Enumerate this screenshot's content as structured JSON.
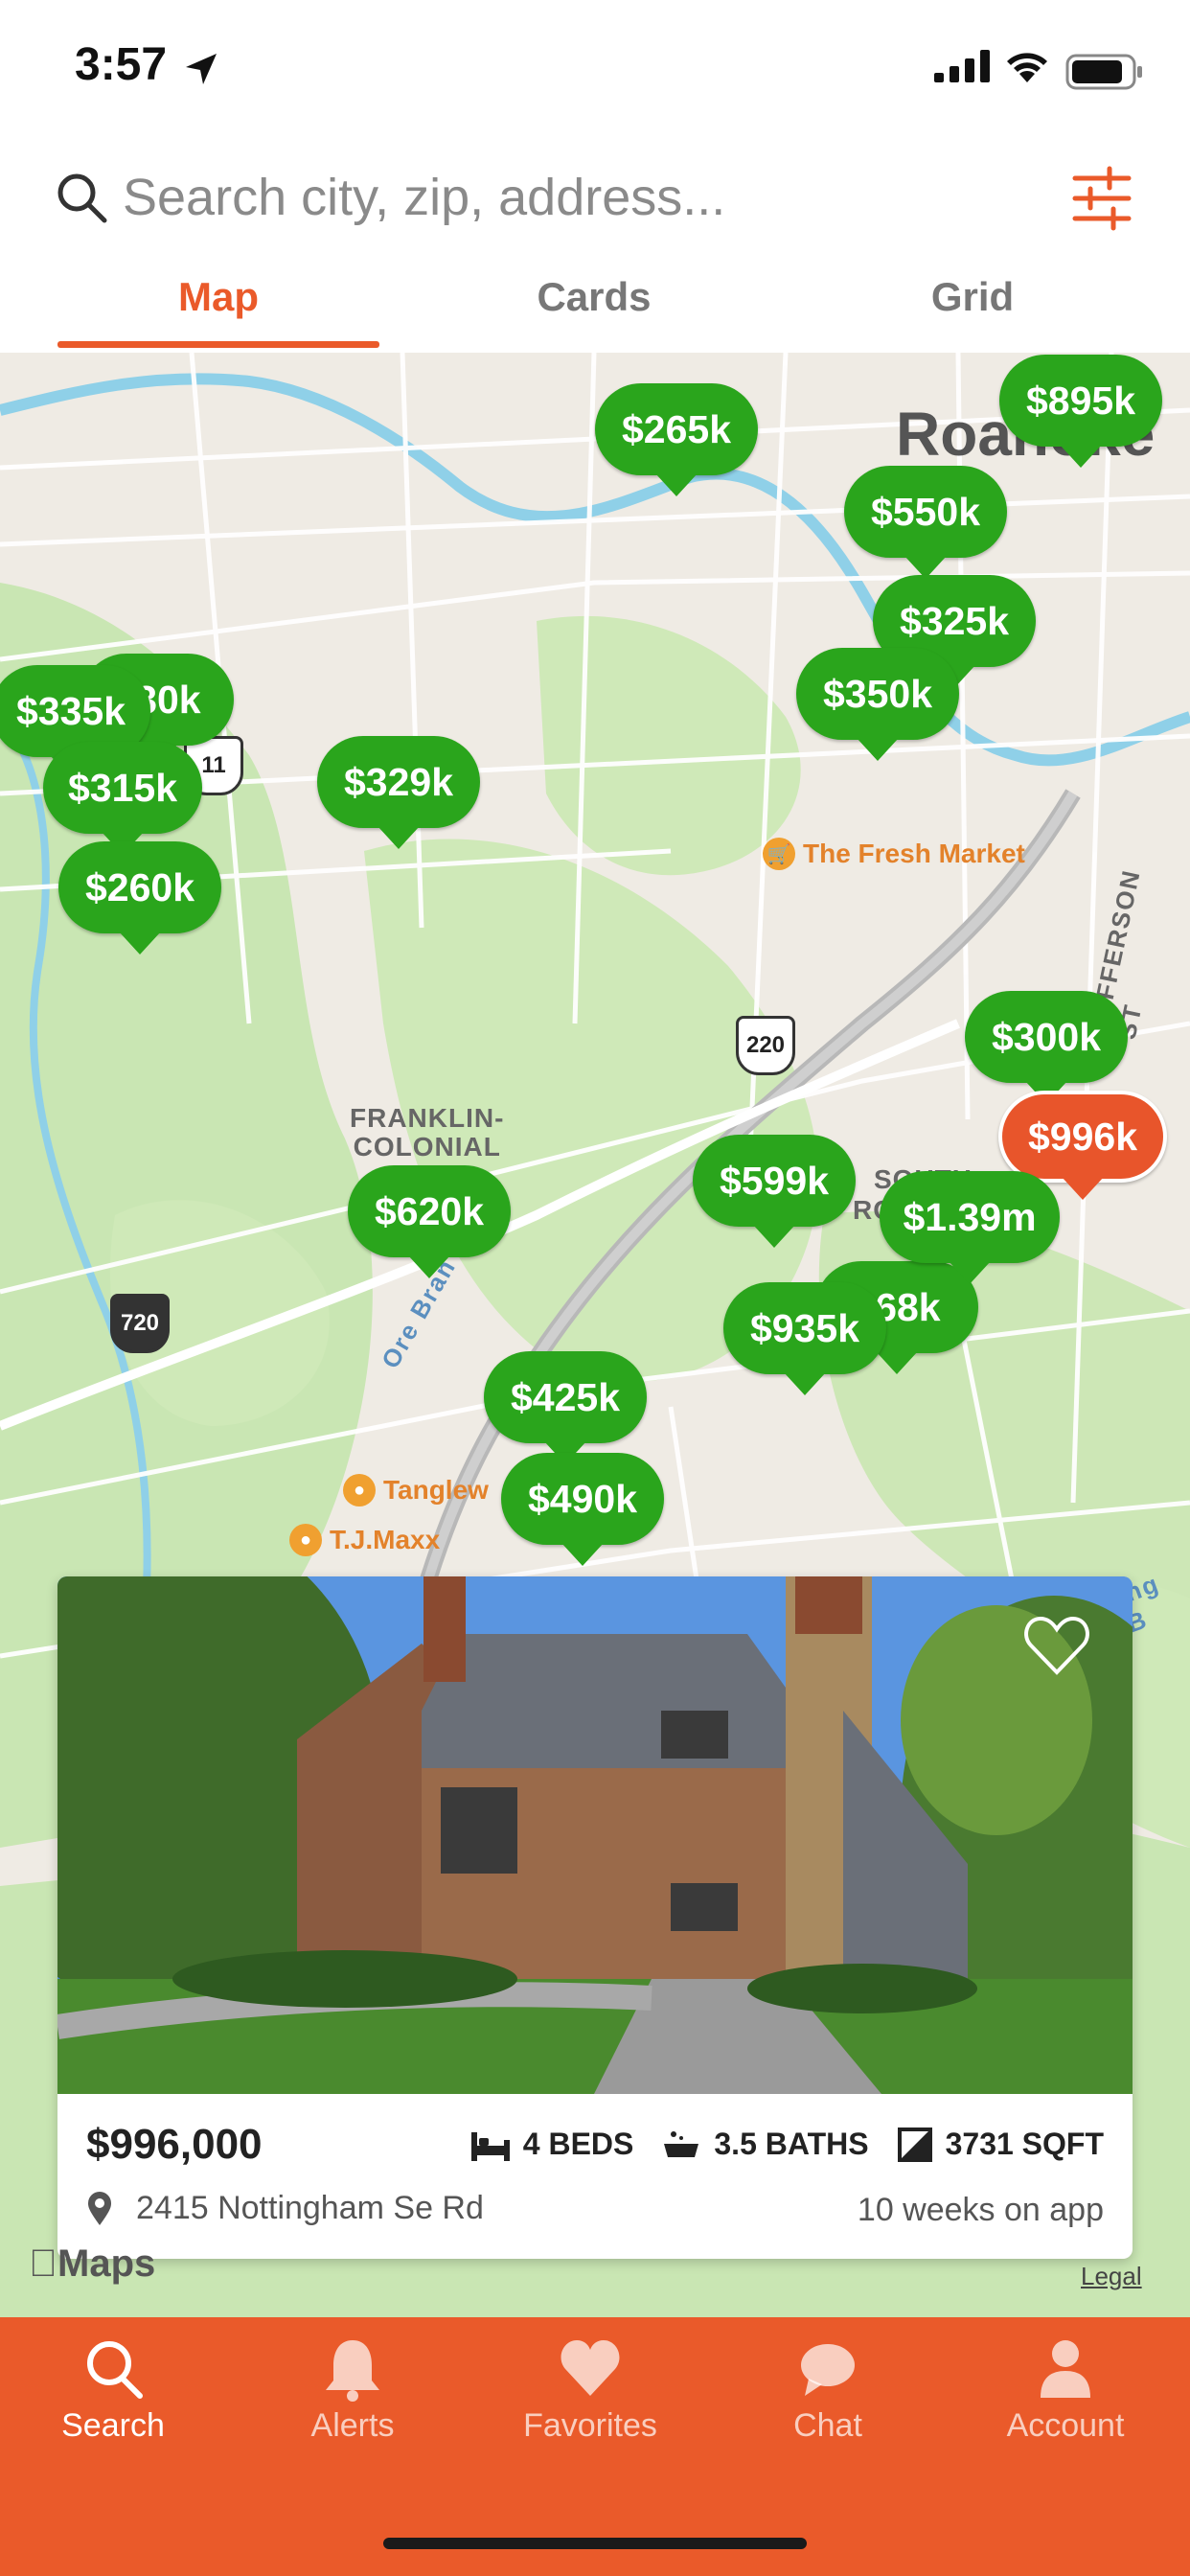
{
  "status_bar": {
    "time": "3:57"
  },
  "search": {
    "placeholder": "Search city, zip, address..."
  },
  "tabs": [
    {
      "label": "Map",
      "active": true
    },
    {
      "label": "Cards",
      "active": false
    },
    {
      "label": "Grid",
      "active": false
    }
  ],
  "map": {
    "city_label": "Roanoke",
    "area_label_line1": "FRANKLIN-",
    "area_label_line2": "COLONIAL",
    "south_label": "SOUTH",
    "south_label2": "RO",
    "street_label": "S JEFFERSON ST",
    "road_ore": "Ore Bran",
    "shields": [
      "11",
      "220",
      "720"
    ],
    "pois": [
      {
        "name": "The Fresh Market",
        "icon": "shopping-cart-icon"
      },
      {
        "name": "Tanglew",
        "icon": "shopping-bag-icon"
      },
      {
        "name": "T.J.Maxx",
        "icon": "shopping-bag-icon"
      }
    ],
    "edge_label": "ing B",
    "pins": [
      {
        "label": "$265k"
      },
      {
        "label": "$895k"
      },
      {
        "label": "$550k"
      },
      {
        "label": "$325k"
      },
      {
        "label": "$350k"
      },
      {
        "label": "$30k"
      },
      {
        "label": "$335k"
      },
      {
        "label": "$315k"
      },
      {
        "label": "$329k"
      },
      {
        "label": "$260k"
      },
      {
        "label": "$300k"
      },
      {
        "label": "$996k",
        "selected": true
      },
      {
        "label": "$599k"
      },
      {
        "label": "$1.39m"
      },
      {
        "label": "$68k"
      },
      {
        "label": "$935k"
      },
      {
        "label": "$620k"
      },
      {
        "label": "$425k"
      },
      {
        "label": "$490k"
      }
    ],
    "maps_logo": "Maps",
    "legal": "Legal"
  },
  "listing": {
    "price": "$996,000",
    "beds": "4 BEDS",
    "baths": "3.5 BATHS",
    "sqft": "3731 SQFT",
    "address": "2415 Nottingham Se Rd",
    "age": "10 weeks on app"
  },
  "nav": [
    {
      "label": "Search",
      "icon": "search-icon",
      "active": true
    },
    {
      "label": "Alerts",
      "icon": "bell-icon",
      "active": false
    },
    {
      "label": "Favorites",
      "icon": "heart-icon",
      "active": false
    },
    {
      "label": "Chat",
      "icon": "chat-bubble-icon",
      "active": false
    },
    {
      "label": "Account",
      "icon": "person-icon",
      "active": false
    }
  ],
  "colors": {
    "accent": "#ea5a2a",
    "pin_green": "#2aa51c",
    "pin_selected": "#e8552b"
  }
}
